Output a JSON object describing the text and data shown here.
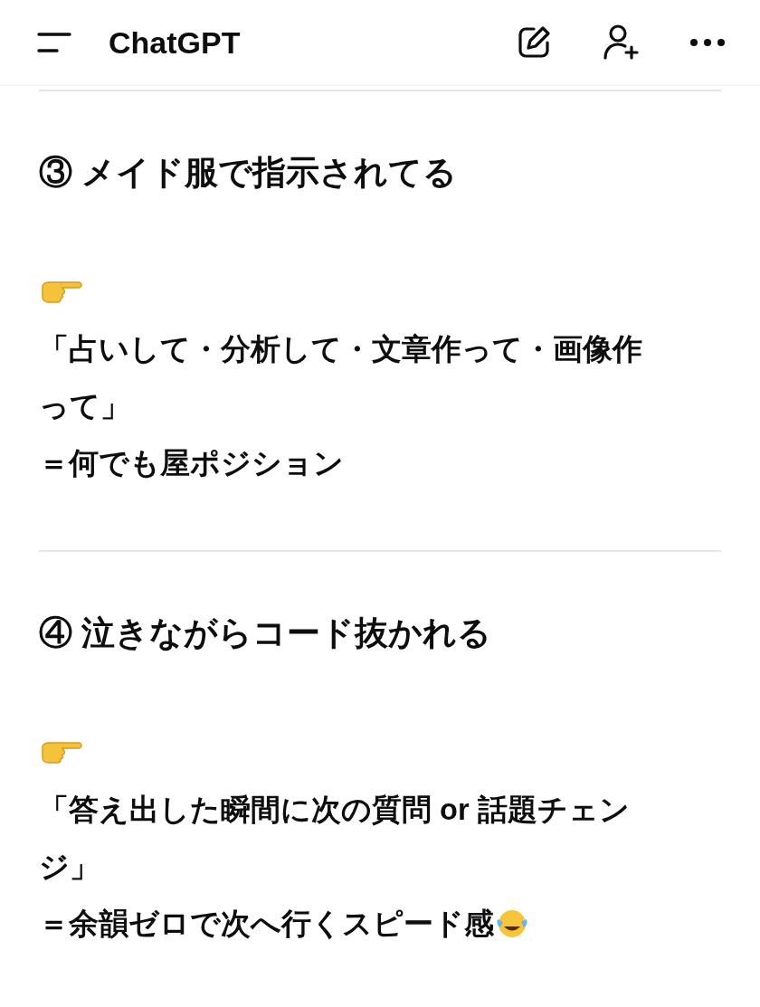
{
  "header": {
    "title": "ChatGPT"
  },
  "sections": [
    {
      "heading": "③ メイド服で指示されてる",
      "lines": [
        {
          "text": "「占いして・分析して・文章作って・画像作って」",
          "laugh_after": false
        },
        {
          "text": "＝何でも屋ポジション",
          "laugh_after": false
        }
      ]
    },
    {
      "heading": "④ 泣きながらコード抜かれる",
      "lines": [
        {
          "text": "「答え出した瞬間に次の質問 or 話題チェンジ」",
          "laugh_after": false
        },
        {
          "text": "＝余韻ゼロで次へ行くスピード感",
          "laugh_after": true
        }
      ]
    }
  ]
}
